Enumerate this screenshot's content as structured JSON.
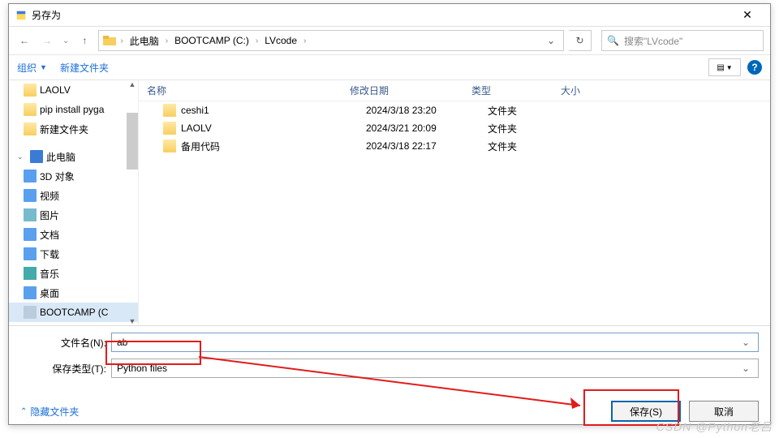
{
  "title": "另存为",
  "breadcrumb": [
    "此电脑",
    "BOOTCAMP (C:)",
    "LVcode"
  ],
  "search_placeholder": "搜索\"LVcode\"",
  "toolbar": {
    "organize": "组织",
    "new_folder": "新建文件夹"
  },
  "tree": {
    "items": [
      {
        "label": "LAOLV",
        "icon": "folder"
      },
      {
        "label": "pip install pyga",
        "icon": "folder"
      },
      {
        "label": "新建文件夹",
        "icon": "folder"
      }
    ],
    "pc_label": "此电脑",
    "pc_children": [
      {
        "label": "3D 对象",
        "icon": "blue"
      },
      {
        "label": "视频",
        "icon": "blue"
      },
      {
        "label": "图片",
        "icon": "pic"
      },
      {
        "label": "文档",
        "icon": "blue"
      },
      {
        "label": "下载",
        "icon": "blue"
      },
      {
        "label": "音乐",
        "icon": "music"
      },
      {
        "label": "桌面",
        "icon": "blue"
      },
      {
        "label": "BOOTCAMP (C",
        "icon": "drive",
        "selected": true
      }
    ]
  },
  "columns": {
    "name": "名称",
    "date": "修改日期",
    "type": "类型",
    "size": "大小"
  },
  "rows": [
    {
      "name": "ceshi1",
      "date": "2024/3/18 23:20",
      "type": "文件夹"
    },
    {
      "name": "LAOLV",
      "date": "2024/3/21 20:09",
      "type": "文件夹"
    },
    {
      "name": "备用代码",
      "date": "2024/3/18 22:17",
      "type": "文件夹"
    }
  ],
  "filename_label": "文件名(N):",
  "filename_value": "ab",
  "savetype_label": "保存类型(T):",
  "savetype_value": "Python files",
  "hide_folders": "隐藏文件夹",
  "buttons": {
    "save": "保存(S)",
    "cancel": "取消"
  },
  "watermark": "CSDN @Python老吕"
}
